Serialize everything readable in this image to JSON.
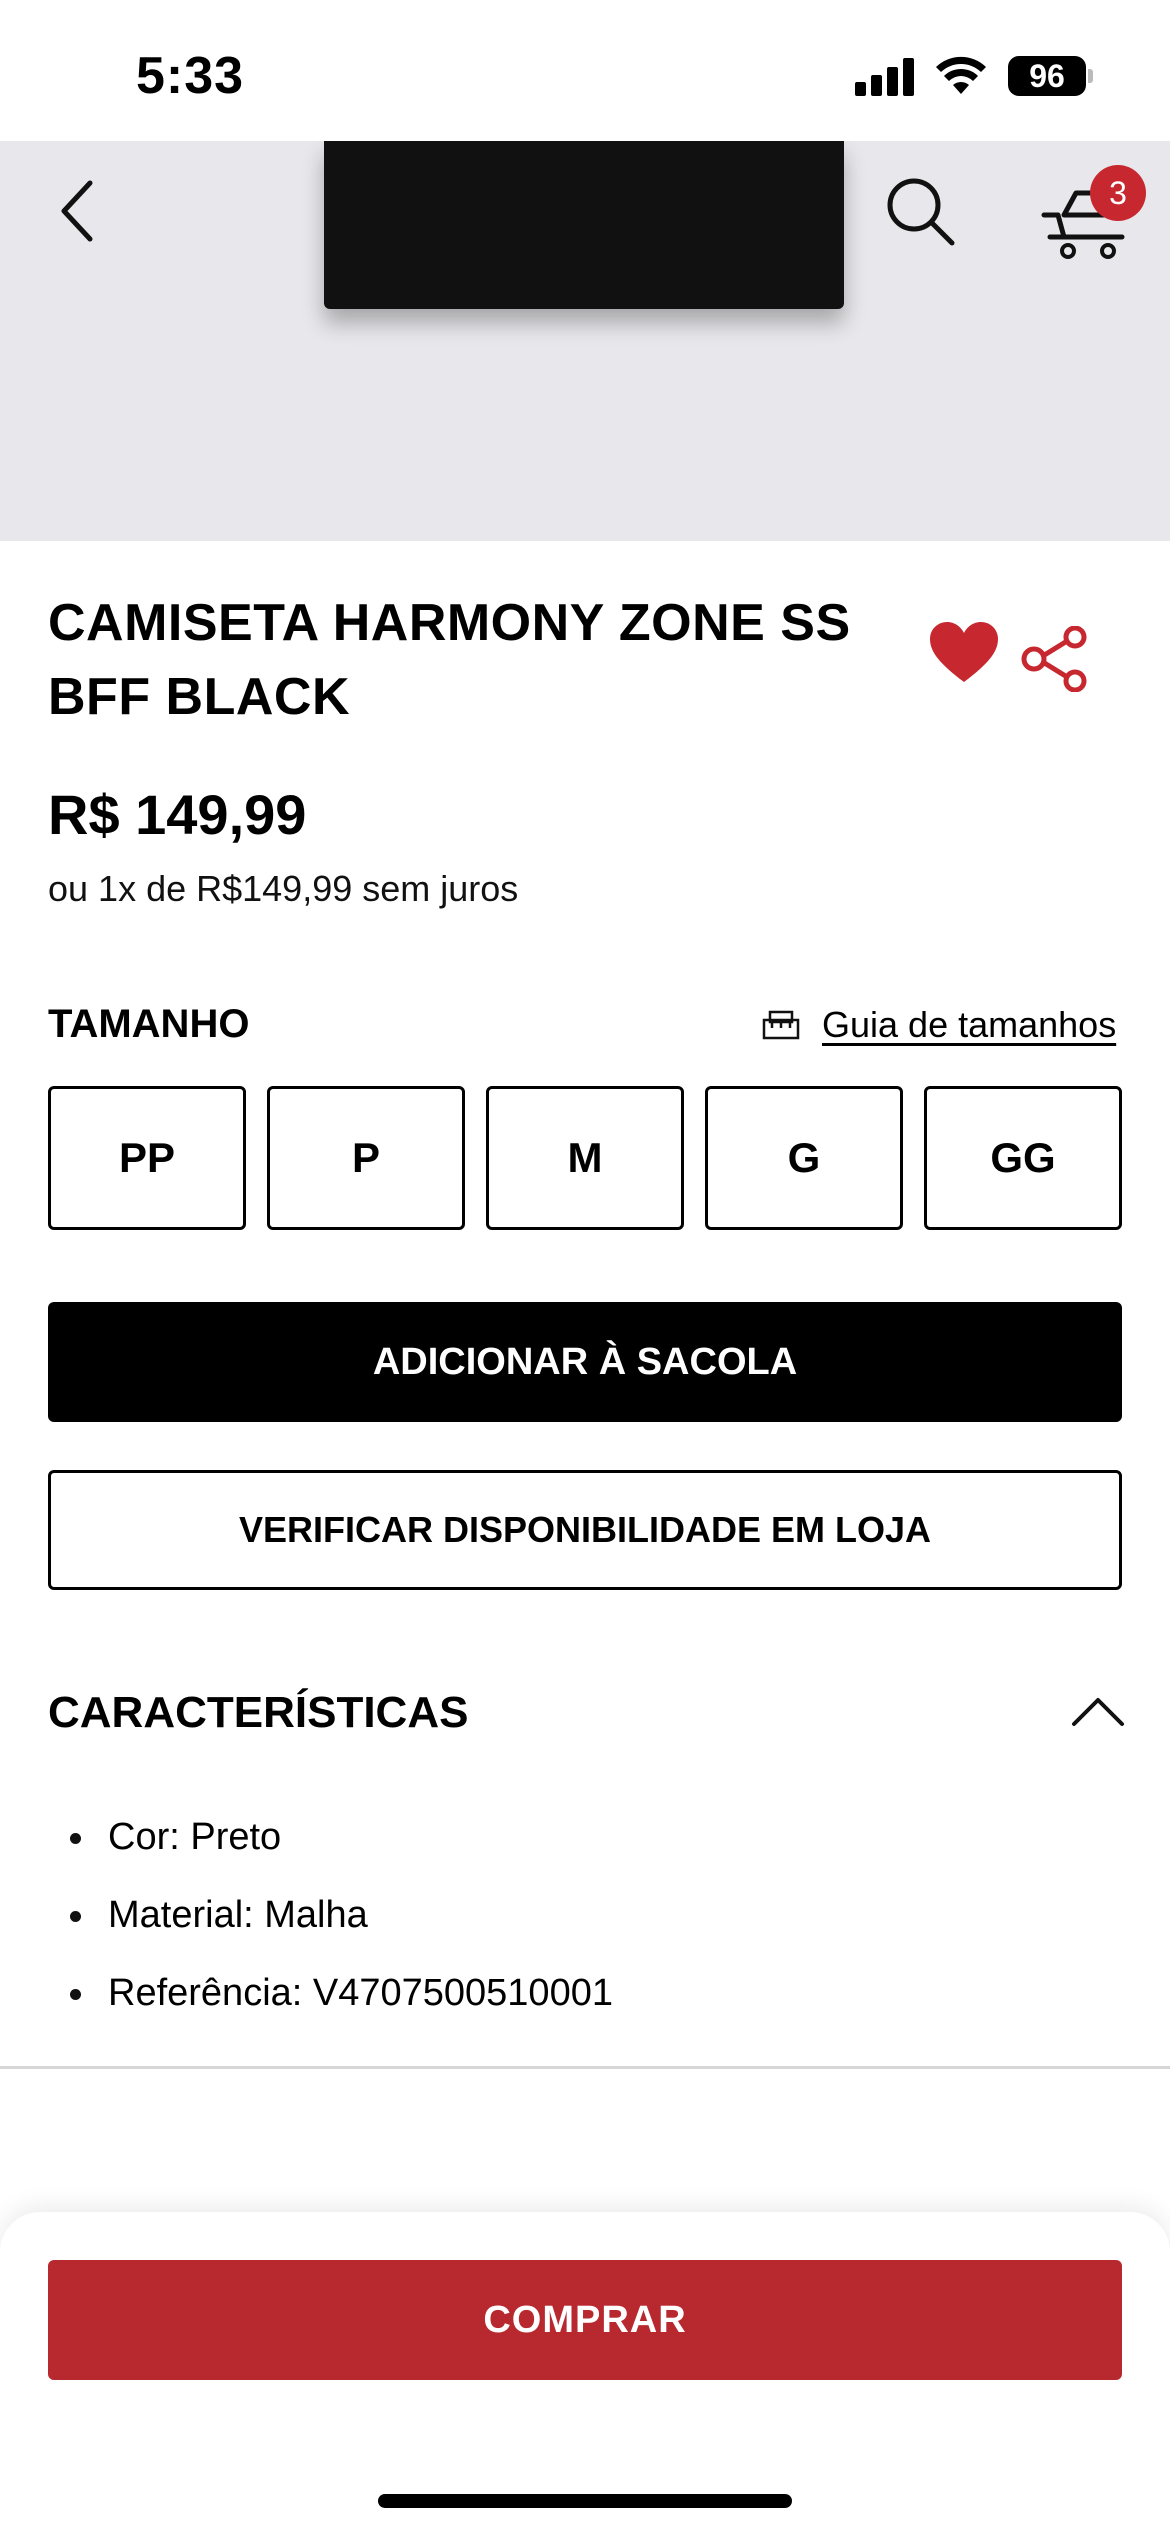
{
  "status_bar": {
    "time": "5:33",
    "battery": "96"
  },
  "header": {
    "cart_count": "3",
    "icons": [
      "chevron-left-icon",
      "search-icon",
      "cart-icon"
    ]
  },
  "product": {
    "title": "CAMISETA HARMONY ZONE SS BFF BLACK",
    "price": "R$ 149,99",
    "installments": "ou 1x de R$149,99 sem juros",
    "favorite_color": "#c7282f"
  },
  "size_section": {
    "label": "TAMANHO",
    "guide_label": "Guia de tamanhos",
    "sizes": [
      "PP",
      "P",
      "M",
      "G",
      "GG"
    ]
  },
  "actions": {
    "add_to_bag": "ADICIONAR À SACOLA",
    "check_store": "VERIFICAR DISPONIBILIDADE EM LOJA",
    "buy": "COMPRAR",
    "buy_color": "#b8282f"
  },
  "features": {
    "title": "CARACTERÍSTICAS",
    "items": [
      "Cor: Preto",
      "Material: Malha",
      "Referência: V4707500510001"
    ]
  }
}
